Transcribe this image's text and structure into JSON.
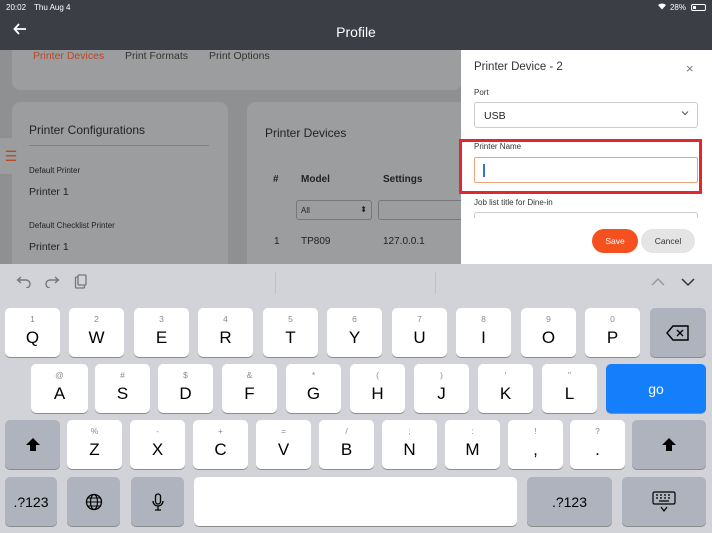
{
  "status_bar": {
    "time": "20:02",
    "date": "Thu Aug 4",
    "battery": "28%"
  },
  "nav": {
    "title": "Profile"
  },
  "tabs": [
    "Printer Devices",
    "Print Formats",
    "Print Options"
  ],
  "printer_configurations": {
    "title": "Printer Configurations",
    "items": [
      {
        "label": "Default Printer",
        "value": "Printer 1"
      },
      {
        "label": "Default Checklist Printer",
        "value": "Printer 1"
      }
    ]
  },
  "printer_devices": {
    "title": "Printer Devices",
    "columns": [
      "#",
      "Model",
      "Settings"
    ],
    "filter_value": "All",
    "rows": [
      {
        "index": "1",
        "model": "TP809",
        "settings": "127.0.0.1"
      }
    ]
  },
  "modal": {
    "title": "Printer Device - 2",
    "close": "×",
    "port_label": "Port",
    "port_value": "USB",
    "printer_name_label": "Printer Name",
    "printer_name_value": "",
    "job_list_label": "Job list title for Dine-in",
    "save_label": "Save",
    "cancel_label": "Cancel"
  },
  "keyboard": {
    "row1": [
      {
        "hint": "1",
        "key": "Q"
      },
      {
        "hint": "2",
        "key": "W"
      },
      {
        "hint": "3",
        "key": "E"
      },
      {
        "hint": "4",
        "key": "R"
      },
      {
        "hint": "5",
        "key": "T"
      },
      {
        "hint": "6",
        "key": "Y"
      },
      {
        "hint": "7",
        "key": "U"
      },
      {
        "hint": "8",
        "key": "I"
      },
      {
        "hint": "9",
        "key": "O"
      },
      {
        "hint": "0",
        "key": "P"
      }
    ],
    "row2": [
      {
        "hint": "@",
        "key": "A"
      },
      {
        "hint": "#",
        "key": "S"
      },
      {
        "hint": "$",
        "key": "D"
      },
      {
        "hint": "&",
        "key": "F"
      },
      {
        "hint": "*",
        "key": "G"
      },
      {
        "hint": "(",
        "key": "H"
      },
      {
        "hint": ")",
        "key": "J"
      },
      {
        "hint": "'",
        "key": "K"
      },
      {
        "hint": "\"",
        "key": "L"
      }
    ],
    "row3": [
      {
        "hint": "%",
        "key": "Z"
      },
      {
        "hint": "-",
        "key": "X"
      },
      {
        "hint": "+",
        "key": "C"
      },
      {
        "hint": "=",
        "key": "V"
      },
      {
        "hint": "/",
        "key": "B"
      },
      {
        "hint": ";",
        "key": "N"
      },
      {
        "hint": ":",
        "key": "M"
      },
      {
        "hint": "!",
        "key": ","
      },
      {
        "hint": "?",
        "key": "."
      }
    ],
    "go_label": "go",
    "numbers_label": ".?123"
  },
  "colors": {
    "accent": "#f4511e",
    "highlight": "#e0282e",
    "key_blue": "#147efb"
  }
}
